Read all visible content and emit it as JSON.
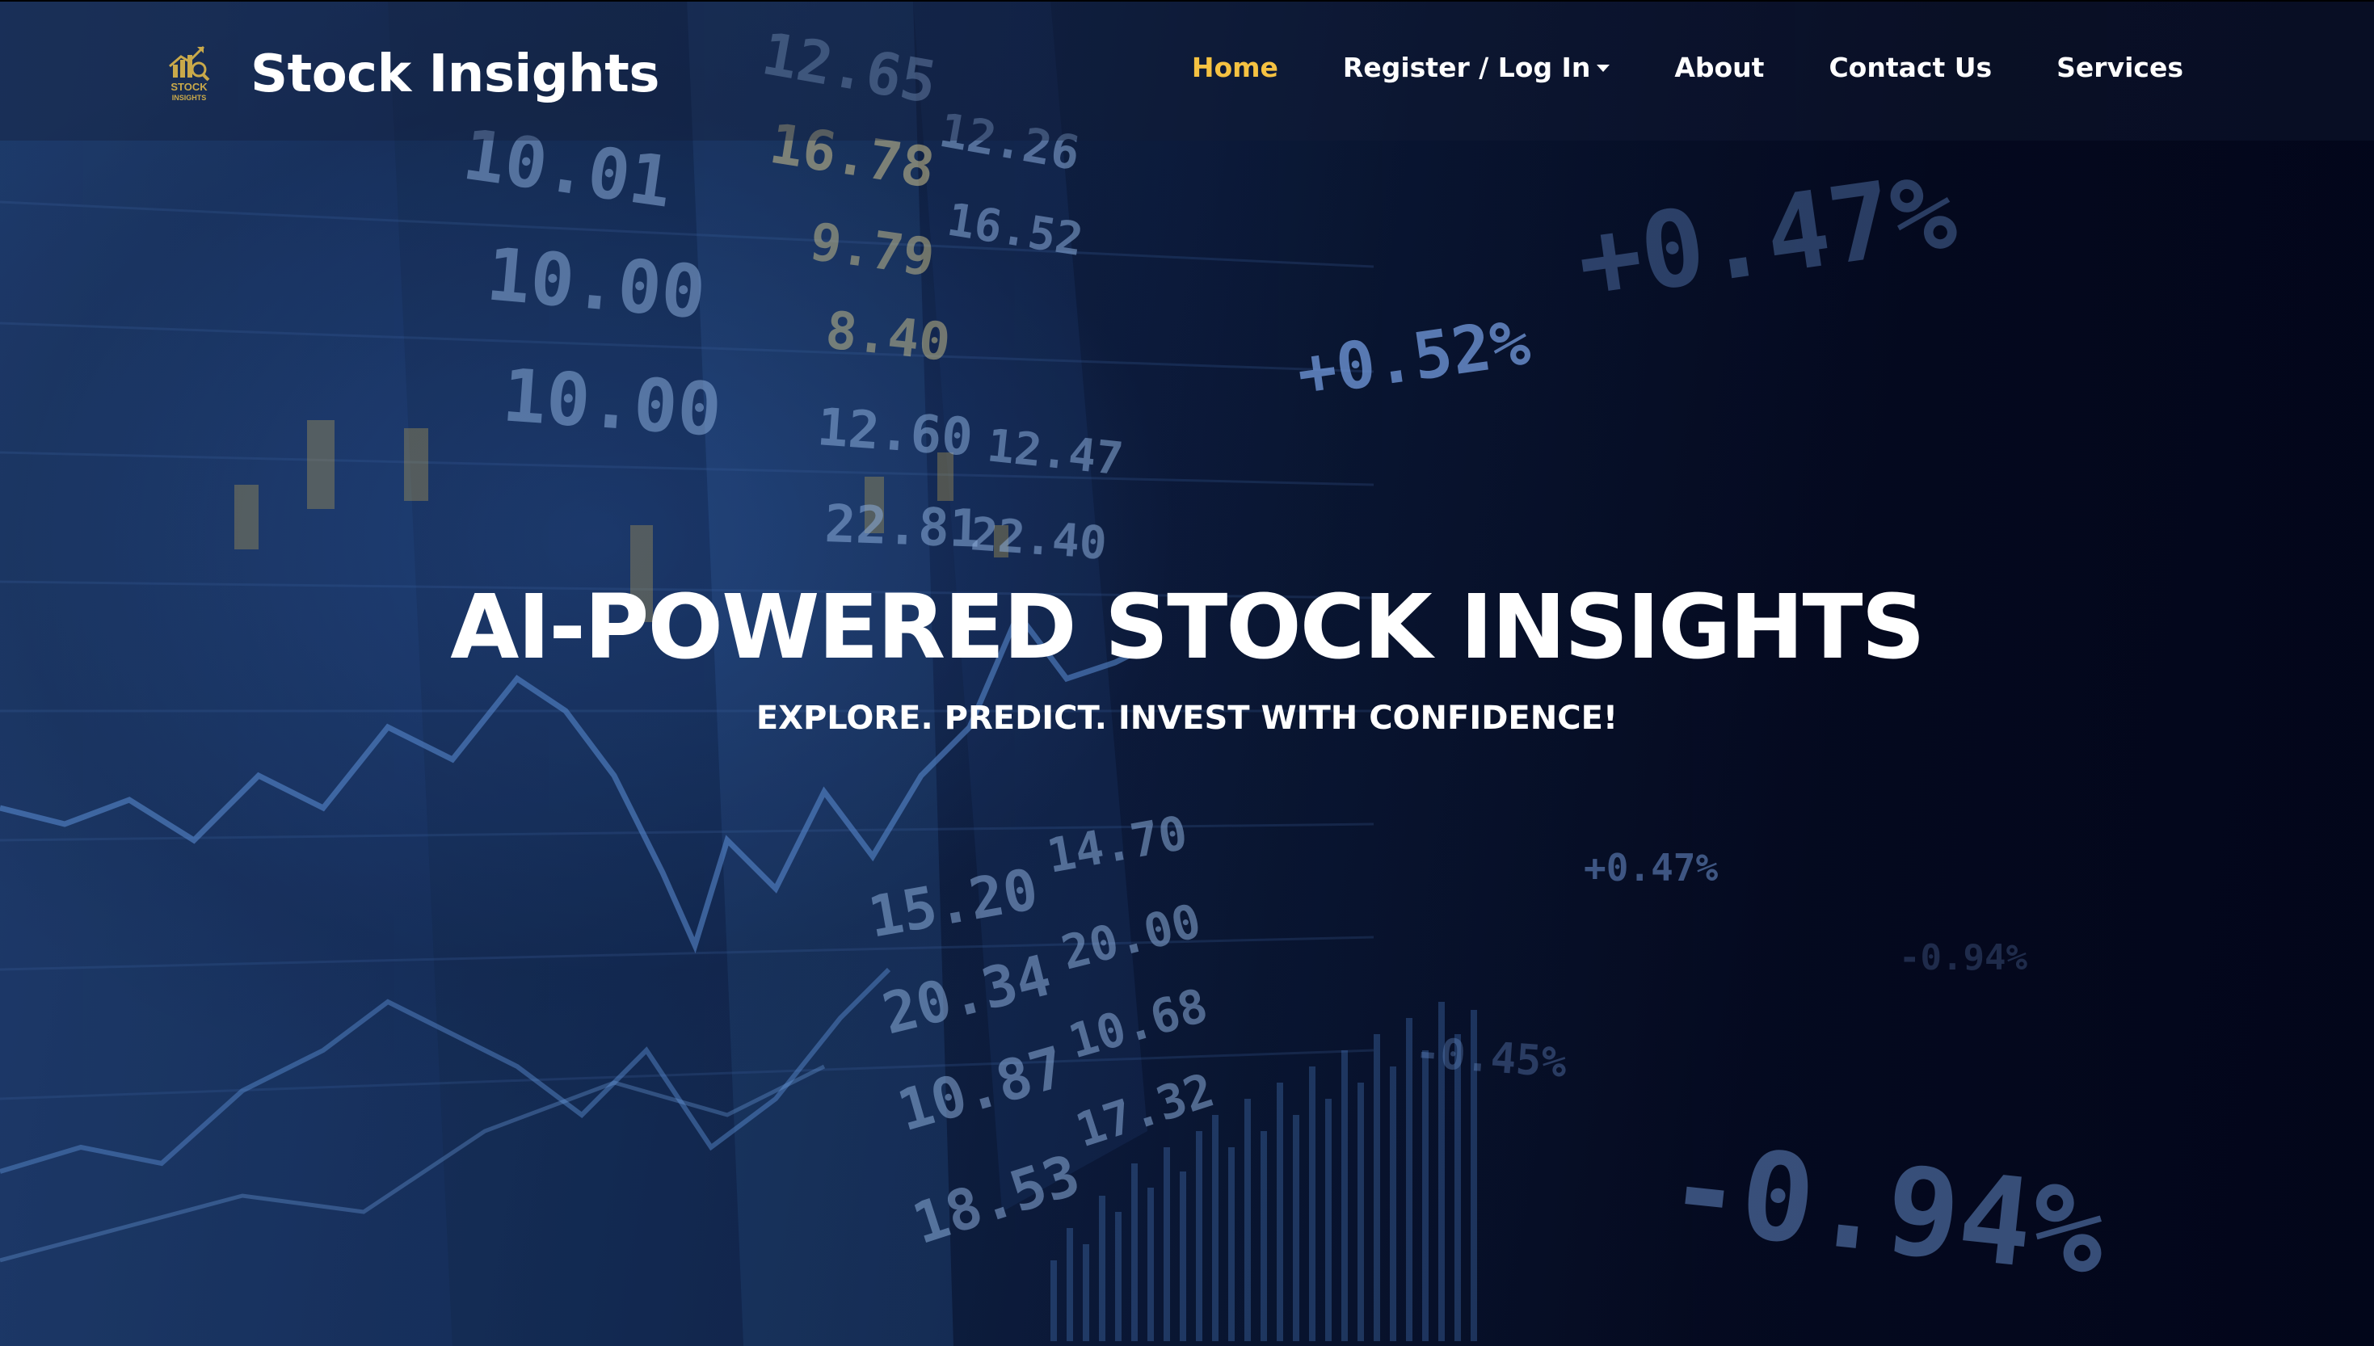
{
  "brand": {
    "logo_text_top": "STOCK",
    "logo_text_bottom": "INSIGHTS",
    "title": "Stock Insights"
  },
  "nav": {
    "home": "Home",
    "register_login": "Register / Log In",
    "about": "About",
    "contact": "Contact Us",
    "services": "Services"
  },
  "hero": {
    "title": "AI-POWERED STOCK INSIGHTS",
    "subtitle": "EXPLORE. PREDICT. INVEST WITH CONFIDENCE!"
  },
  "colors": {
    "accent": "#f5c242",
    "text": "#ffffff",
    "background": "#04071a"
  },
  "background_ticker_numbers": [
    "12.65",
    "16.78",
    "10.01",
    "9.79",
    "8.40",
    "10.00",
    "10.00",
    "12.60",
    "22.81",
    "12.26",
    "16.52",
    "12.47",
    "22.40",
    "15.20",
    "20.34",
    "10.87",
    "18.53",
    "14.70",
    "20.00",
    "10.68",
    "17.32",
    "+0.52%",
    "+0.47%",
    "-0.94%",
    "+0.47%",
    "-0.45%",
    "-0.94%"
  ]
}
